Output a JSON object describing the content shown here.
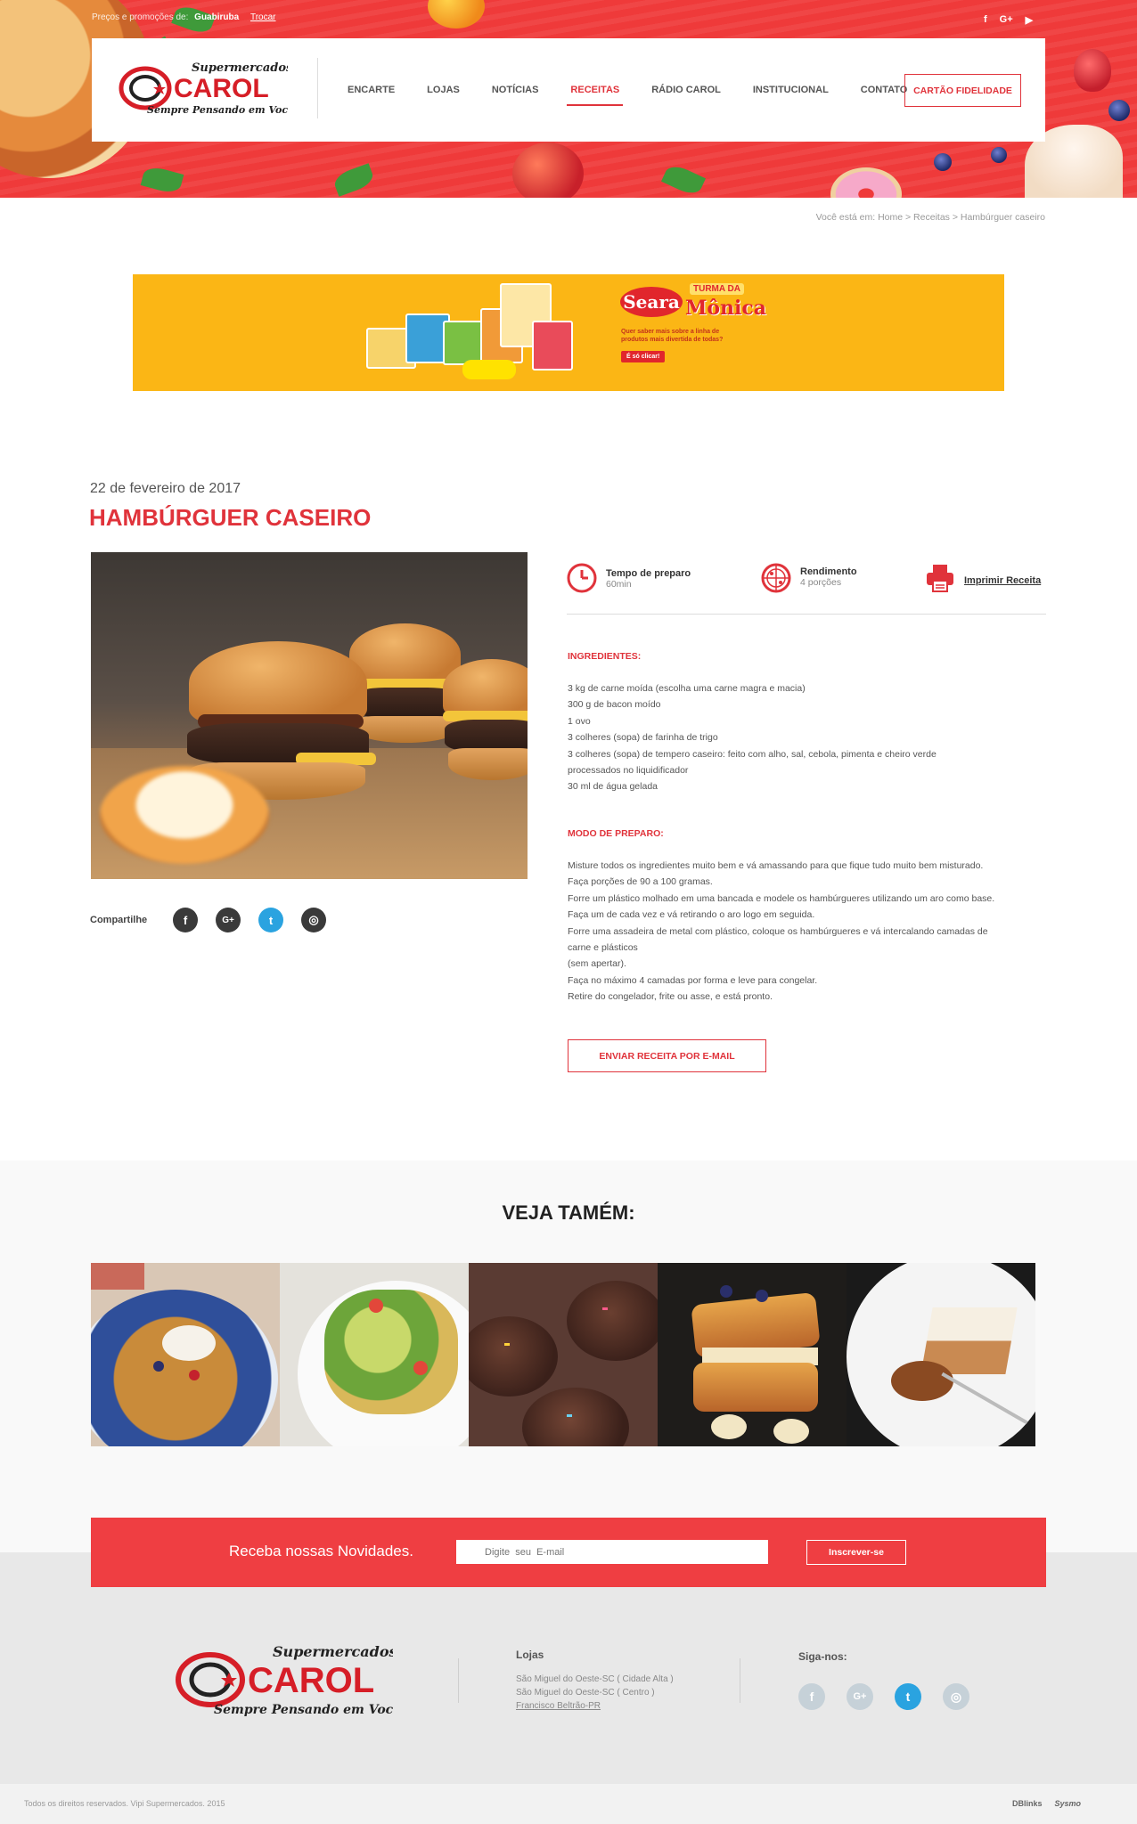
{
  "topbar": {
    "prefix": "Preços e promoções de:",
    "city": "Guabiruba",
    "change_label": "Trocar"
  },
  "top_social": [
    "f",
    "G+",
    "▶"
  ],
  "brand": {
    "line1": "Supermercados",
    "name": "CAROL",
    "tagline": "Sempre Pensando em Você",
    "mono": "CS"
  },
  "nav": {
    "items": [
      "ENCARTE",
      "LOJAS",
      "NOTÍCIAS",
      "RECEITAS",
      "RÁDIO CAROL",
      "INSTITUCIONAL",
      "CONTATO"
    ],
    "active_index": 3,
    "loyalty_button": "CARTÃO FIDELIDADE"
  },
  "breadcrumb": "Você está em: Home > Receitas > Hambúrguer caseiro",
  "banner": {
    "seara": "Seara",
    "turma": "TURMA DA",
    "monica": "Mônica",
    "question": "Quer saber mais sobre a linha de produtos mais divertida de todas?",
    "cta": "É só clicar!"
  },
  "recipe": {
    "date": "22 de fevereiro de 2017",
    "title": "HAMBÚRGUER CASEIRO",
    "prep_label": "Tempo de preparo",
    "prep_value": "60min",
    "yield_label": "Rendimento",
    "yield_value": "4 porções",
    "print_label": "Imprimir Receita",
    "ingredients_heading": "INGREDIENTES:",
    "ingredients": [
      "3 kg de carne moída (escolha uma carne magra e macia)",
      "300 g de bacon moído",
      "1 ovo",
      "3 colheres (sopa) de farinha de trigo",
      "3 colheres (sopa) de tempero caseiro: feito com alho, sal, cebola, pimenta e cheiro verde",
      "processados no liquidificador",
      "30 ml de água gelada"
    ],
    "method_heading": "MODO DE PREPARO:",
    "method": [
      "Misture todos os ingredientes muito bem e vá amassando para que fique tudo muito bem misturado.",
      "Faça porções de 90 a 100 gramas.",
      "Forre um plástico molhado em uma bancada e modele os hambúrgueres utilizando um aro como base.",
      "Faça um de cada vez e vá retirando o aro logo em seguida.",
      "Forre uma assadeira de metal com plástico, coloque os hambúrgueres e vá intercalando camadas de",
      "carne e plásticos",
      "(sem apertar).",
      "Faça no máximo 4 camadas por forma e leve para congelar.",
      "Retire do congelador, frite ou asse, e está pronto."
    ],
    "send_button": "ENVIAR RECEITA POR E-MAIL"
  },
  "share": {
    "label": "Compartilhe",
    "icons": [
      "f",
      "G+",
      "t",
      "◎"
    ]
  },
  "see_also": {
    "title": "VEJA TAMÉM:"
  },
  "newsletter": {
    "label": "Receba nossas Novidades.",
    "placeholder": "Digite  seu  E-mail",
    "button": "Inscrever-se"
  },
  "footer": {
    "stores_heading": "Lojas",
    "stores": [
      "São Miguel do Oeste-SC ( Cidade Alta )",
      "São Miguel do Oeste-SC ( Centro )",
      "Francisco Beltrão-PR"
    ],
    "follow_heading": "Siga-nos:",
    "follow_icons": [
      "f",
      "G+",
      "t",
      "◎"
    ],
    "copyright": "Todos os direitos reservados. Vipi Supermercados. 2015",
    "credit1": "DBlinks",
    "credit2": "Sysmo"
  },
  "colors": {
    "brand_red": "#e0333b",
    "facebook_dark": "#3a3a3a",
    "twitter": "#2aa3e0",
    "footer_social": "#c6d1d8"
  }
}
